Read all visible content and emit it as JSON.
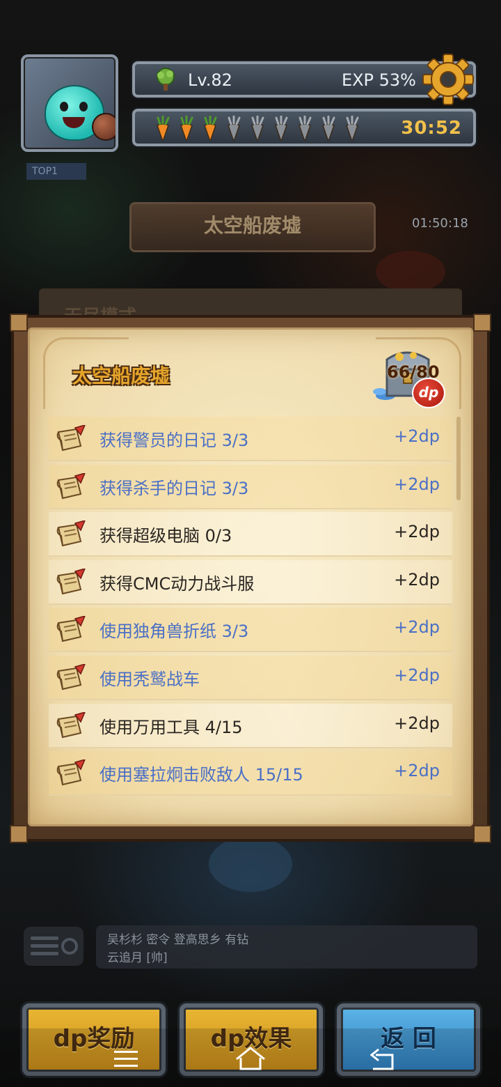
{
  "hud": {
    "level": "Lv.82",
    "exp": "EXP 53%",
    "stamina_full": 3,
    "stamina_total": 9,
    "timer": "30:52"
  },
  "map": {
    "stage_banner": "太空船废墟",
    "side_timer": "01:50:18",
    "top_badge": "TOP1",
    "background_label": "无尽模式"
  },
  "panel": {
    "title": "太空船废墟",
    "chest_count": "66/80",
    "dp_badge": "dp",
    "tasks": [
      {
        "text": "获得警员的日记 3/3",
        "points": "+2dp",
        "done": true
      },
      {
        "text": "获得杀手的日记 3/3",
        "points": "+2dp",
        "done": true
      },
      {
        "text": "获得超级电脑 0/3",
        "points": "+2dp",
        "done": false
      },
      {
        "text": "获得CMC动力战斗服",
        "points": "+2dp",
        "done": false
      },
      {
        "text": "使用独角兽折纸 3/3",
        "points": "+2dp",
        "done": true
      },
      {
        "text": "使用秃鹫战车",
        "points": "+2dp",
        "done": true
      },
      {
        "text": "使用万用工具 4/15",
        "points": "+2dp",
        "done": false
      },
      {
        "text": "使用塞拉炯击败敌人 15/15",
        "points": "+2dp",
        "done": true
      }
    ]
  },
  "chat": {
    "line1": "吴杉杉  密令 登高思乡 有钻",
    "line2": "云追月 [帅]"
  },
  "buttons": {
    "dp_reward": "dp奖励",
    "dp_effect": "dp效果",
    "back": "返 回"
  },
  "colors": {
    "done_text": "#4a6fc6",
    "todo_text": "#2a2521",
    "title_gold": "#e6a52c",
    "timer_gold": "#f2c14a"
  },
  "icons": {
    "nav": [
      "menu-icon",
      "home-icon",
      "back-icon"
    ],
    "row": "quest-scroll-icon",
    "settings": "gear-icon"
  }
}
